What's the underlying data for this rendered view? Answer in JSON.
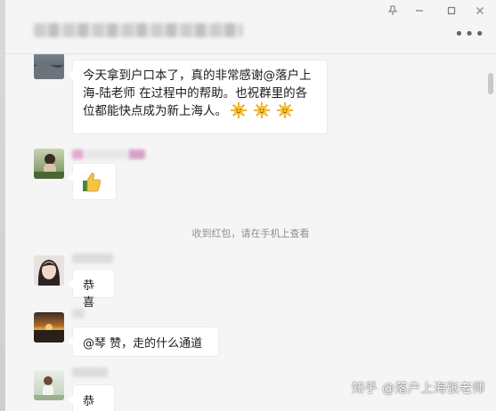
{
  "window": {
    "pin_icon": "pin-icon",
    "minimize_icon": "minimize-icon",
    "maximize_icon": "maximize-icon",
    "close_icon": "close-icon",
    "more_icon": "more-dots-icon"
  },
  "messages": [
    {
      "type": "text",
      "text_line1": "今天拿到户口本了，真的非常感谢@落户上",
      "text_line2": "海-陆老师 在过程中的帮助。也祝群里的各",
      "text_line3": "位都能快点成为新上海人。",
      "emoji": [
        "sun-emoji",
        "sun-emoji",
        "sun-emoji"
      ]
    },
    {
      "type": "emoji",
      "emoji": "thumbs-up-emoji"
    },
    {
      "type": "system",
      "text": "收到红包，请在手机上查看"
    },
    {
      "type": "text",
      "text": "恭喜"
    },
    {
      "type": "text",
      "text": "@琴 赞，走的什么通道"
    },
    {
      "type": "text",
      "text": "恭喜"
    }
  ],
  "watermark": "知乎 @落户上海张老师",
  "colors": {
    "background": "#f5f5f5",
    "bubble": "#ffffff",
    "system_text": "#8f8f8f"
  }
}
